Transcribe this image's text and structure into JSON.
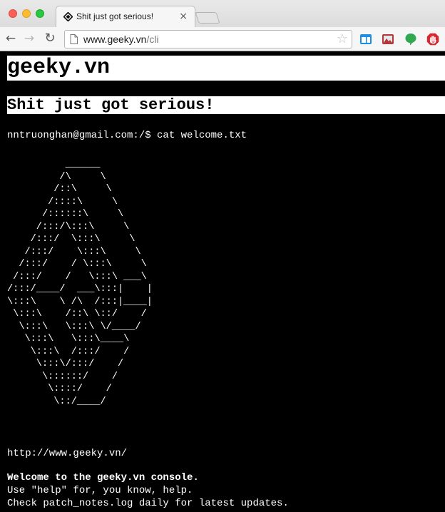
{
  "browser": {
    "tab": {
      "title": "Shit just got serious!",
      "close_glyph": "×",
      "favicon": "geeky-diamond-icon"
    },
    "nav": {
      "back_glyph": "←",
      "forward_glyph": "→",
      "reload_glyph": "↻"
    },
    "address": {
      "host": "www.geeky.vn",
      "path": "/cli"
    },
    "star_glyph": "☆",
    "extensions": [
      "window-extension-icon",
      "photo-extension-icon",
      "chat-bubble-extension-icon",
      "stop-hand-extension-icon"
    ]
  },
  "page": {
    "site_title": "geeky.vn",
    "tagline": "Shit just got serious!",
    "prompt": "nntruonghan@gmail.com:/$ cat welcome.txt",
    "ascii_art": [
      "          ______",
      "         /\\     \\",
      "        /::\\     \\",
      "       /::::\\     \\",
      "      /::::::\\     \\",
      "     /:::/\\:::\\     \\",
      "    /:::/  \\:::\\     \\",
      "   /:::/    \\:::\\     \\",
      "  /:::/    / \\:::\\     \\",
      " /:::/    /   \\:::\\ ___\\",
      "/:::/____/  ___\\:::|    |",
      "\\:::\\    \\ /\\  /:::|____|",
      " \\:::\\    /::\\ \\::/    /",
      "  \\:::\\   \\:::\\ \\/____/",
      "   \\:::\\   \\:::\\____\\",
      "    \\:::\\  /:::/    /",
      "     \\:::\\/:::/    /",
      "      \\::::::/    /",
      "       \\::::/    /",
      "        \\::/____/"
    ],
    "url": "http://www.geeky.vn/",
    "welcome": "Welcome to the geeky.vn console.",
    "help_line": "Use \"help\" for, you know, help.",
    "patch_line": "Check patch_notes.log daily for latest updates."
  }
}
